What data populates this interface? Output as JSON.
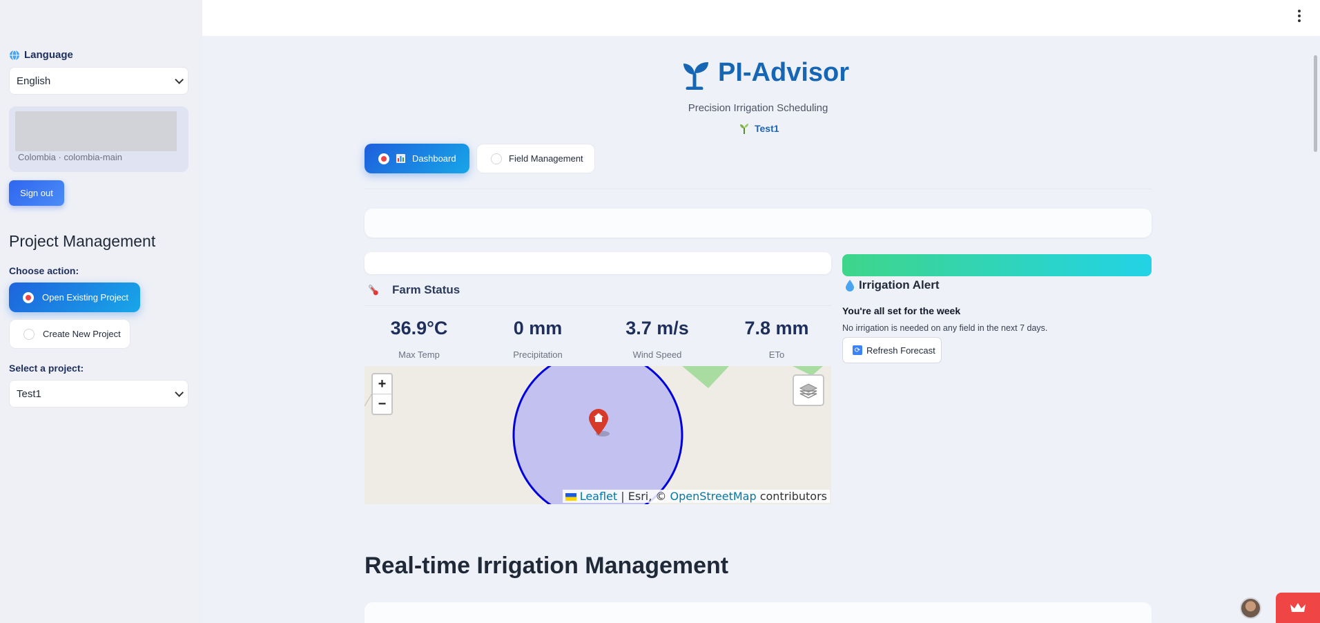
{
  "sidebar": {
    "language_label": "Language",
    "language_value": "English",
    "user_meta": "Colombia · colombia-main",
    "signout_label": "Sign out",
    "pm_title": "Project Management",
    "choose_action_label": "Choose action:",
    "actions": [
      {
        "label": "Open Existing Project",
        "selected": true
      },
      {
        "label": "Create New Project",
        "selected": false
      }
    ],
    "select_project_label": "Select a project:",
    "project_value": "Test1"
  },
  "header": {
    "title": "PI-Advisor",
    "subtitle": "Precision Irrigation Scheduling",
    "project_tag": "Test1"
  },
  "tabs": [
    {
      "label": "Dashboard",
      "icon": "bar-chart-icon",
      "selected": true
    },
    {
      "label": "Field Management",
      "selected": false
    }
  ],
  "farm_status": {
    "title": "Farm Status",
    "metrics": [
      {
        "value": "36.9°C",
        "label": "Max Temp"
      },
      {
        "value": "0 mm",
        "label": "Precipitation"
      },
      {
        "value": "3.7 m/s",
        "label": "Wind Speed"
      },
      {
        "value": "7.8 mm",
        "label": "ETo"
      }
    ]
  },
  "map": {
    "zoom_in": "+",
    "zoom_out": "−",
    "attribution_leaflet": "Leaflet",
    "attribution_mid": "| Esri, ©",
    "attribution_osm": "OpenStreetMap",
    "attribution_end": "contributors"
  },
  "irrigation_alert": {
    "title": "Irrigation Alert",
    "heading": "You're all set for the week",
    "text": "No irrigation is needed on any field in the next 7 days.",
    "refresh_label": "Refresh Forecast"
  },
  "section_title": "Real-time Irrigation Management",
  "colors": {
    "accent": "#1e63dd",
    "title_blue": "#1766b4",
    "alert_gradient_start": "#3ed58a",
    "alert_gradient_end": "#22d3e6",
    "map_circle": "#0000dd"
  }
}
